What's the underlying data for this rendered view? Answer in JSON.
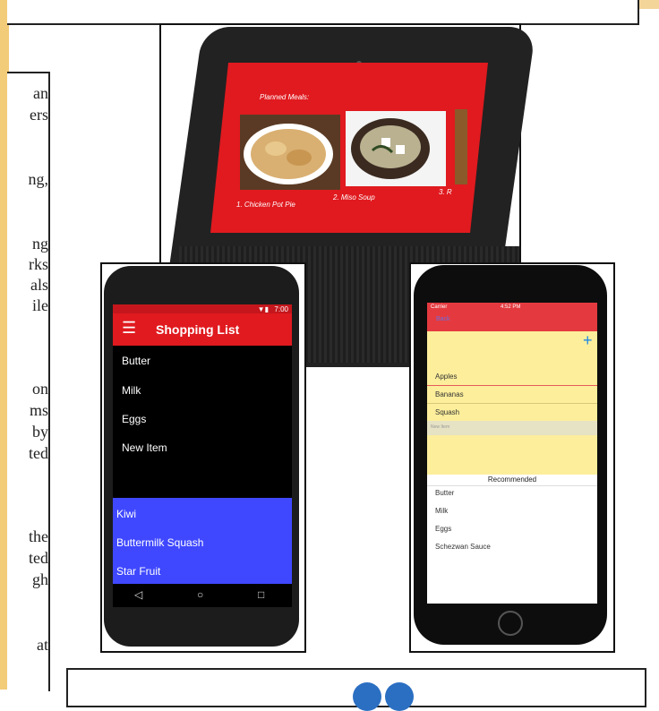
{
  "page": {
    "text_fragments": [
      "an",
      "ers",
      "ng,",
      "ng",
      "rks",
      "als",
      "ile",
      "on",
      "ms",
      "by",
      "ted",
      "the",
      "ted",
      "gh",
      "at"
    ]
  },
  "echo_show": {
    "header": "Planned Meals:",
    "meals": [
      {
        "label": "1. Chicken Pot Pie"
      },
      {
        "label": "2. Miso Soup"
      },
      {
        "label": "3. R"
      }
    ]
  },
  "android": {
    "status_time": "7:00",
    "title": "Shopping List",
    "items": [
      "Butter",
      "Milk",
      "Eggs",
      "New Item"
    ],
    "recommended": [
      "Kiwi",
      "Buttermilk Squash",
      "Star Fruit"
    ],
    "accent_color": "#e01a1f",
    "recommend_color": "#3f48ff"
  },
  "ios": {
    "carrier": "Carrier",
    "time": "4:52 PM",
    "nav_back": "Back",
    "add_symbol": "+",
    "items": [
      "Apples",
      "Bananas",
      "Squash"
    ],
    "new_item_placeholder": "New Item",
    "recommended_header": "Recommended",
    "recommended": [
      "Butter",
      "Milk",
      "Eggs",
      "Schezwan Sauce"
    ]
  }
}
